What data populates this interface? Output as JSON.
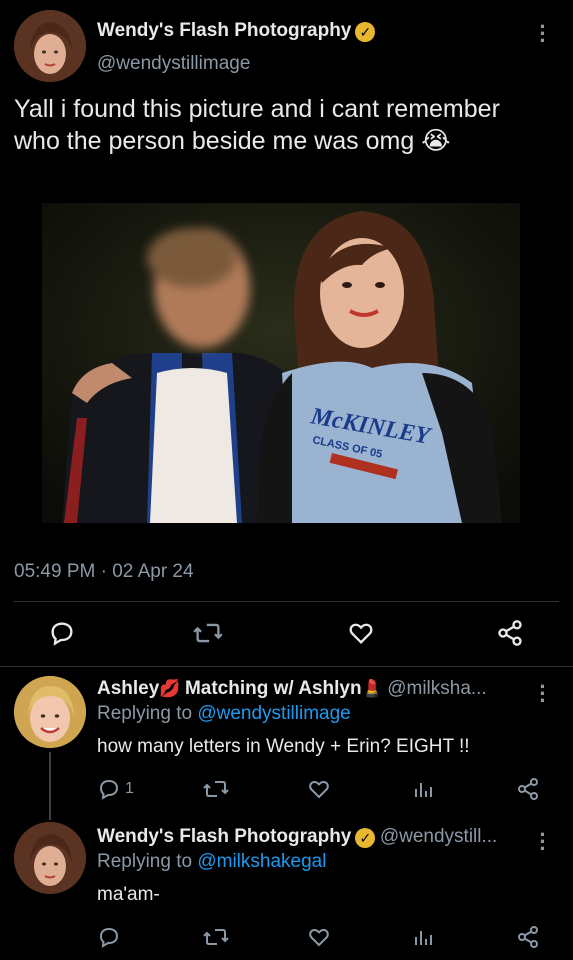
{
  "tweet": {
    "author_name": "Wendy's Flash Photography",
    "author_handle": "@wendystillimage",
    "text_line1": "Yall i found this picture and i cant remember",
    "text_line2": "who the person beside me was omg",
    "emoji": "😭",
    "timestamp": "05:49 PM · 02 Apr 24",
    "shirt_text": "McKINLEY",
    "shirt_subtext": "CLASS OF 05"
  },
  "replies": [
    {
      "author_name": "Ashley",
      "name_emoji_1": "💋",
      "name_middle": "Matching w/ Ashlyn",
      "name_emoji_2": "💄",
      "author_handle": "@milksha...",
      "replying_prefix": "Replying to",
      "replying_to": "@wendystillimage",
      "text": "how many letters in Wendy + Erin? EIGHT !!",
      "reply_count": "1"
    },
    {
      "author_name": "Wendy's Flash Photography",
      "author_handle": "@wendystill...",
      "replying_prefix": "Replying to",
      "replying_to": "@milkshakegal",
      "text": "ma'am-",
      "reply_count": ""
    }
  ],
  "colors": {
    "background": "#000000",
    "text": "#e7e9ea",
    "muted": "#8b98a5",
    "link": "#1d9bf0",
    "verified": "#e8b730"
  }
}
